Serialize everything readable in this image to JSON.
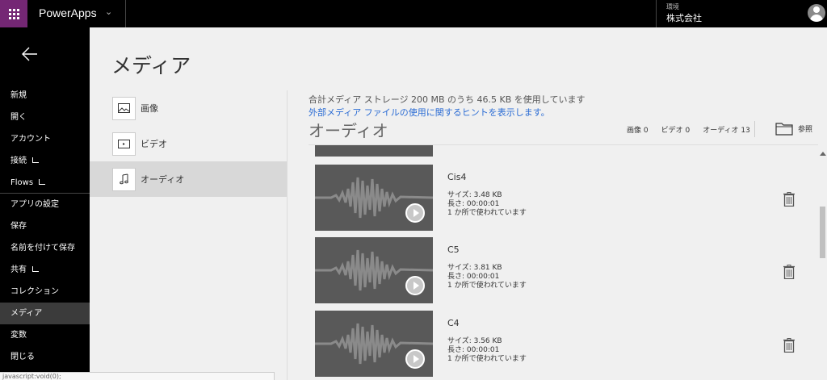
{
  "topbar": {
    "app_title": "PowerApps",
    "env_label": "環境",
    "env_name": "株式会社"
  },
  "leftnav": {
    "items": [
      {
        "label": "新規"
      },
      {
        "label": "開く"
      },
      {
        "label": "アカウント"
      },
      {
        "label": "接続"
      },
      {
        "label": "Flows"
      },
      {
        "label": "アプリの設定"
      },
      {
        "label": "保存"
      },
      {
        "label": "名前を付けて保存"
      },
      {
        "label": "共有"
      },
      {
        "label": "コレクション"
      },
      {
        "label": "メディア"
      },
      {
        "label": "変数"
      },
      {
        "label": "閉じる"
      }
    ]
  },
  "main": {
    "title": "メディア",
    "tabs": [
      {
        "label": "画像"
      },
      {
        "label": "ビデオ"
      },
      {
        "label": "オーディオ"
      }
    ],
    "storage_info": "合計メディア ストレージ 200 MB のうち 46.5 KB を使用しています",
    "hint_link": "外部メディア ファイルの使用に関するヒントを表示します。",
    "section_title": "オーディオ",
    "counts": {
      "images": "画像 0",
      "videos": "ビデオ 0",
      "audio": "オーディオ 13"
    },
    "browse_label": "参照",
    "items": [
      {
        "name": "Cis4",
        "size": "サイズ: 3.48 KB",
        "length": "長さ: 00:00:01",
        "usage": "1 か所で使われています"
      },
      {
        "name": "C5",
        "size": "サイズ: 3.81 KB",
        "length": "長さ: 00:00:01",
        "usage": "1 か所で使われています"
      },
      {
        "name": "C4",
        "size": "サイズ: 3.56 KB",
        "length": "長さ: 00:00:01",
        "usage": "1 か所で使われています"
      }
    ]
  },
  "status_bar": "javascript:void(0);"
}
